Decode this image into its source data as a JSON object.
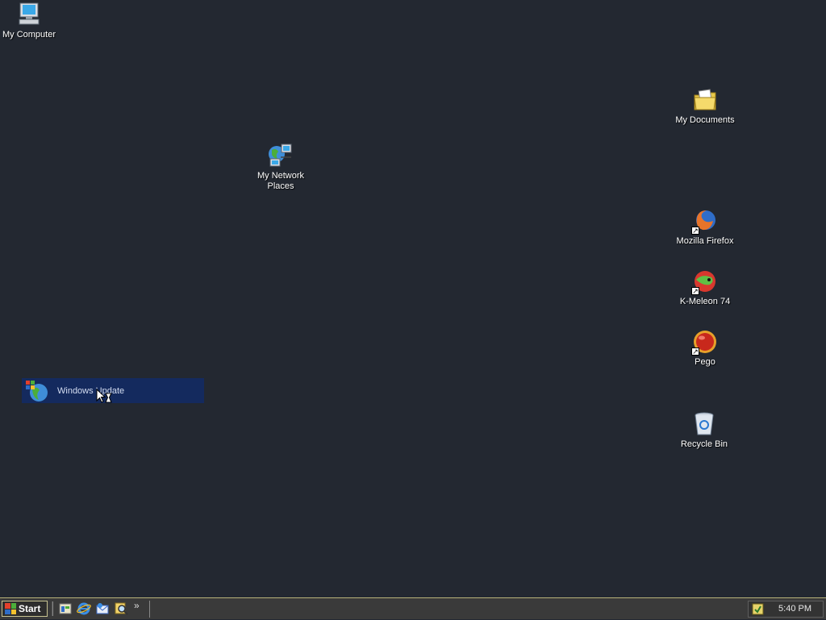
{
  "desktop": {
    "icons": [
      {
        "label": "My Computer",
        "icon": "computer-icon"
      },
      {
        "label": "My Documents",
        "icon": "folder-documents-icon"
      },
      {
        "label": "My Network Places",
        "icon": "network-places-icon"
      },
      {
        "label": "Mozilla Firefox",
        "icon": "firefox-icon"
      },
      {
        "label": "K-Meleon 74",
        "icon": "kmeleon-icon"
      },
      {
        "label": "Pego",
        "icon": "pego-icon"
      },
      {
        "label": "Recycle Bin",
        "icon": "recycle-bin-icon"
      }
    ],
    "selected_item": {
      "label": "Windows Update",
      "icon": "windows-update-icon"
    }
  },
  "taskbar": {
    "start_label": "Start",
    "quick_launch": [
      "show-desktop-icon",
      "internet-explorer-icon",
      "outlook-express-icon",
      "search-icon"
    ],
    "overflow": "»",
    "clock": "5:40 PM"
  },
  "colors": {
    "desktop": "#232831",
    "taskbar": "#3a3a3a",
    "selection": "#142a5e"
  }
}
